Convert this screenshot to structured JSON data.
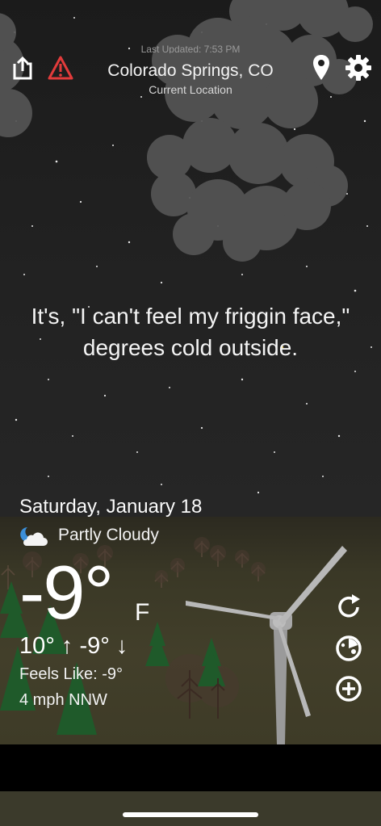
{
  "header": {
    "updated_text": "Last Updated: 7:53 PM",
    "city": "Colorado Springs, CO",
    "subtitle": "Current Location"
  },
  "icons": {
    "share": "share-icon",
    "alert": "warning-triangle-icon",
    "location": "location-pin-icon",
    "settings": "gear-icon",
    "condition": "partly-cloudy-night-icon",
    "refresh": "refresh-icon",
    "radar": "radar-icon",
    "add": "add-location-icon"
  },
  "message": "It's, \"I can't feel my friggin face,\" degrees cold outside.",
  "weather": {
    "date": "Saturday, January 18",
    "condition": "Partly Cloudy",
    "temperature": "-9°",
    "unit": "F",
    "high_low": "10° ↑  -9° ↓",
    "feels_like": "Feels Like: -9°",
    "wind": "4 mph NNW"
  },
  "colors": {
    "alert": "#e23b3b",
    "text": "#ffffff",
    "sky": "#1b1b1b",
    "ground": "#3e3b27"
  }
}
